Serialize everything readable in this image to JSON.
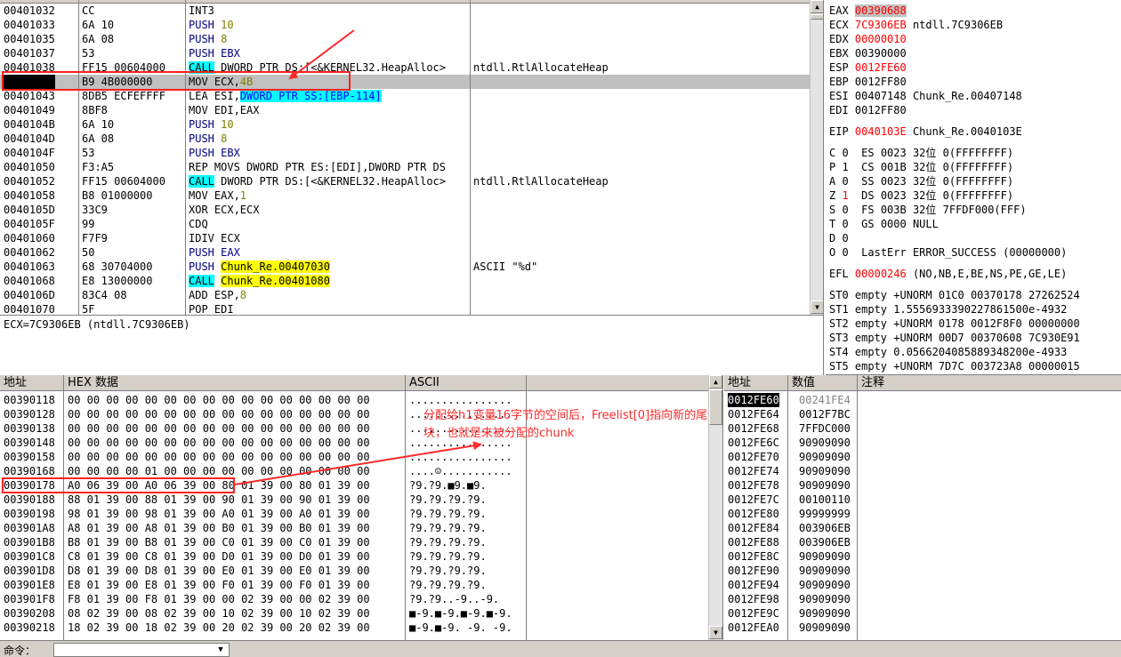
{
  "disasm": {
    "rows": [
      {
        "addr": "00401032",
        "hex": "CC",
        "asm": [
          {
            "t": "INT3"
          }
        ],
        "cmt": ""
      },
      {
        "addr": "00401033",
        "hex": "6A 10",
        "asm": [
          {
            "t": "PUSH ",
            "c": "kw-push"
          },
          {
            "t": "10",
            "c": "num"
          }
        ],
        "cmt": ""
      },
      {
        "addr": "00401035",
        "hex": "6A 08",
        "asm": [
          {
            "t": "PUSH ",
            "c": "kw-push"
          },
          {
            "t": "8",
            "c": "num"
          }
        ],
        "cmt": ""
      },
      {
        "addr": "00401037",
        "hex": "53",
        "asm": [
          {
            "t": "PUSH EBX",
            "c": "kw-push"
          }
        ],
        "cmt": ""
      },
      {
        "addr": "00401038",
        "hex": "FF15 00604000",
        "asm": [
          {
            "t": "CALL",
            "c": "kw-call"
          },
          {
            "t": " DWORD PTR DS:[<&KERNEL32.HeapAlloc>"
          }
        ],
        "cmt": "ntdll.RtlAllocateHeap"
      },
      {
        "addr": "0040103E",
        "hex": "B9 4B000000",
        "asm": [
          {
            "t": "MOV ECX,"
          },
          {
            "t": "4B",
            "c": "num"
          }
        ],
        "cmt": "",
        "cur": true
      },
      {
        "addr": "00401043",
        "hex": "8DB5 ECFEFFFF",
        "asm": [
          {
            "t": "LEA ESI,"
          },
          {
            "t": "DWORD PTR SS:[EBP-114]",
            "c": "hl-c"
          }
        ],
        "cmt": ""
      },
      {
        "addr": "00401049",
        "hex": "8BF8",
        "asm": [
          {
            "t": "MOV EDI,EAX"
          }
        ],
        "cmt": ""
      },
      {
        "addr": "0040104B",
        "hex": "6A 10",
        "asm": [
          {
            "t": "PUSH ",
            "c": "kw-push"
          },
          {
            "t": "10",
            "c": "num"
          }
        ],
        "cmt": ""
      },
      {
        "addr": "0040104D",
        "hex": "6A 08",
        "asm": [
          {
            "t": "PUSH ",
            "c": "kw-push"
          },
          {
            "t": "8",
            "c": "num"
          }
        ],
        "cmt": ""
      },
      {
        "addr": "0040104F",
        "hex": "53",
        "asm": [
          {
            "t": "PUSH EBX",
            "c": "kw-push"
          }
        ],
        "cmt": ""
      },
      {
        "addr": "00401050",
        "hex": "F3:A5",
        "asm": [
          {
            "t": "REP MOVS DWORD PTR ES:[EDI],DWORD PTR DS"
          }
        ],
        "cmt": ""
      },
      {
        "addr": "00401052",
        "hex": "FF15 00604000",
        "asm": [
          {
            "t": "CALL",
            "c": "kw-call"
          },
          {
            "t": " DWORD PTR DS:[<&KERNEL32.HeapAlloc>"
          }
        ],
        "cmt": "ntdll.RtlAllocateHeap"
      },
      {
        "addr": "00401058",
        "hex": "B8 01000000",
        "asm": [
          {
            "t": "MOV EAX,"
          },
          {
            "t": "1",
            "c": "num"
          }
        ],
        "cmt": ""
      },
      {
        "addr": "0040105D",
        "hex": "33C9",
        "asm": [
          {
            "t": "XOR ECX,ECX"
          }
        ],
        "cmt": ""
      },
      {
        "addr": "0040105F",
        "hex": "99",
        "asm": [
          {
            "t": "CDQ"
          }
        ],
        "cmt": ""
      },
      {
        "addr": "00401060",
        "hex": "F7F9",
        "asm": [
          {
            "t": "IDIV ECX"
          }
        ],
        "cmt": ""
      },
      {
        "addr": "00401062",
        "hex": "50",
        "asm": [
          {
            "t": "PUSH EAX",
            "c": "kw-push"
          }
        ],
        "cmt": ""
      },
      {
        "addr": "00401063",
        "hex": "68 30704000",
        "asm": [
          {
            "t": "PUSH ",
            "c": "kw-push"
          },
          {
            "t": "Chunk_Re.00407030",
            "c": "hl-y"
          }
        ],
        "cmt": "ASCII \"%d\""
      },
      {
        "addr": "00401068",
        "hex": "E8 13000000",
        "asm": [
          {
            "t": "CALL",
            "c": "kw-call"
          },
          {
            "t": " "
          },
          {
            "t": "Chunk_Re.00401080",
            "c": "hl-y"
          }
        ],
        "cmt": ""
      },
      {
        "addr": "0040106D",
        "hex": "83C4 08",
        "asm": [
          {
            "t": "ADD ESP,"
          },
          {
            "t": "8",
            "c": "num"
          }
        ],
        "cmt": ""
      },
      {
        "addr": "00401070",
        "hex": "5F",
        "asm": [
          {
            "t": "POP EDI"
          }
        ],
        "cmt": ""
      }
    ],
    "info": "ECX=7C9306EB (ntdll.7C9306EB)"
  },
  "registers": [
    {
      "name": "EAX",
      "val": "00390688",
      "style": "redbg",
      "cmt": ""
    },
    {
      "name": "ECX",
      "val": "7C9306EB",
      "style": "red",
      "cmt": "ntdll.7C9306EB"
    },
    {
      "name": "EDX",
      "val": "00000010",
      "style": "red",
      "cmt": ""
    },
    {
      "name": "EBX",
      "val": "00390000",
      "style": "",
      "cmt": ""
    },
    {
      "name": "ESP",
      "val": "0012FE60",
      "style": "red",
      "cmt": ""
    },
    {
      "name": "EBP",
      "val": "0012FF80",
      "style": "",
      "cmt": ""
    },
    {
      "name": "ESI",
      "val": "00407148",
      "style": "",
      "cmt": "Chunk_Re.00407148"
    },
    {
      "name": "EDI",
      "val": "0012FF80",
      "style": "",
      "cmt": ""
    },
    {
      "name": "EIP",
      "val": "0040103E",
      "style": "red",
      "cmt": "Chunk_Re.0040103E",
      "gap": true
    }
  ],
  "flags": [
    {
      "f": "C",
      "v": "0",
      "seg": "ES 0023 32位 0(FFFFFFFF)",
      "red": false
    },
    {
      "f": "P",
      "v": "1",
      "seg": "CS 001B 32位 0(FFFFFFFF)",
      "red": false
    },
    {
      "f": "A",
      "v": "0",
      "seg": "SS 0023 32位 0(FFFFFFFF)",
      "red": false
    },
    {
      "f": "Z",
      "v": "1",
      "seg": "DS 0023 32位 0(FFFFFFFF)",
      "red": true
    },
    {
      "f": "S",
      "v": "0",
      "seg": "FS 003B 32位 7FFDF000(FFF)",
      "red": false
    },
    {
      "f": "T",
      "v": "0",
      "seg": "GS 0000 NULL",
      "red": false
    },
    {
      "f": "D",
      "v": "0",
      "seg": "",
      "red": false
    },
    {
      "f": "O",
      "v": "0",
      "seg": "LastErr ERROR_SUCCESS (00000000)",
      "red": false
    }
  ],
  "efl": {
    "name": "EFL",
    "val": "00000246",
    "cmt": "(NO,NB,E,BE,NS,PE,GE,LE)"
  },
  "fpu": [
    "ST0 empty +UNORM 01C0 00370178 27262524",
    "ST1 empty 1.5556933390227861500e-4932",
    "ST2 empty +UNORM 0178 0012F8F0 00000000",
    "ST3 empty +UNORM 00D7 00370608 7C930E91",
    "ST4 empty 0.0566204085889348200e-4933",
    "ST5 empty +UNORM 7D7C 003723A8 00000015"
  ],
  "dump": {
    "headers": {
      "addr": "地址",
      "hex": "HEX 数据",
      "ascii": "ASCII"
    },
    "rows": [
      {
        "addr": "00390118",
        "hex": "00 00 00 00 00 00 00 00 00 00 00 00 00 00 00 00",
        "asc": "................"
      },
      {
        "addr": "00390128",
        "hex": "00 00 00 00 00 00 00 00 00 00 00 00 00 00 00 00",
        "asc": "................"
      },
      {
        "addr": "00390138",
        "hex": "00 00 00 00 00 00 00 00 00 00 00 00 00 00 00 00",
        "asc": "................"
      },
      {
        "addr": "00390148",
        "hex": "00 00 00 00 00 00 00 00 00 00 00 00 00 00 00 00",
        "asc": "................"
      },
      {
        "addr": "00390158",
        "hex": "00 00 00 00 00 00 00 00 00 00 00 00 00 00 00 00",
        "asc": "................"
      },
      {
        "addr": "00390168",
        "hex": "00 00 00 00 01 00 00 00 00 00 00 00 00 00 00 00",
        "asc": "....☺..........."
      },
      {
        "addr": "00390178",
        "hex": "A0 06 39 00 A0 06 39 00 80 01 39 00 80 01 39 00",
        "asc": "?9.?9.■9.■9."
      },
      {
        "addr": "00390188",
        "hex": "88 01 39 00 88 01 39 00 90 01 39 00 90 01 39 00",
        "asc": "?9.?9.?9.?9."
      },
      {
        "addr": "00390198",
        "hex": "98 01 39 00 98 01 39 00 A0 01 39 00 A0 01 39 00",
        "asc": "?9.?9.?9.?9."
      },
      {
        "addr": "003901A8",
        "hex": "A8 01 39 00 A8 01 39 00 B0 01 39 00 B0 01 39 00",
        "asc": "?9.?9.?9.?9."
      },
      {
        "addr": "003901B8",
        "hex": "B8 01 39 00 B8 01 39 00 C0 01 39 00 C0 01 39 00",
        "asc": "?9.?9.?9.?9."
      },
      {
        "addr": "003901C8",
        "hex": "C8 01 39 00 C8 01 39 00 D0 01 39 00 D0 01 39 00",
        "asc": "?9.?9.?9.?9."
      },
      {
        "addr": "003901D8",
        "hex": "D8 01 39 00 D8 01 39 00 E0 01 39 00 E0 01 39 00",
        "asc": "?9.?9.?9.?9."
      },
      {
        "addr": "003901E8",
        "hex": "E8 01 39 00 E8 01 39 00 F0 01 39 00 F0 01 39 00",
        "asc": "?9.?9.?9.?9."
      },
      {
        "addr": "003901F8",
        "hex": "F8 01 39 00 F8 01 39 00 00 02 39 00 00 02 39 00",
        "asc": "?9.?9..-9..-9."
      },
      {
        "addr": "00390208",
        "hex": "08 02 39 00 08 02 39 00 10 02 39 00 10 02 39 00",
        "asc": "■-9.■-9.■-9.■-9."
      },
      {
        "addr": "00390218",
        "hex": "18 02 39 00 18 02 39 00 20 02 39 00 20 02 39 00",
        "asc": "■-9.■-9. -9. -9."
      }
    ]
  },
  "stack": {
    "headers": {
      "addr": "地址",
      "val": "数值",
      "cmt": "注释"
    },
    "rows": [
      {
        "addr": "0012FE60",
        "val": "00241FE4",
        "sel": true
      },
      {
        "addr": "0012FE64",
        "val": "0012F7BC"
      },
      {
        "addr": "0012FE68",
        "val": "7FFDC000"
      },
      {
        "addr": "0012FE6C",
        "val": "90909090"
      },
      {
        "addr": "0012FE70",
        "val": "90909090"
      },
      {
        "addr": "0012FE74",
        "val": "90909090"
      },
      {
        "addr": "0012FE78",
        "val": "90909090"
      },
      {
        "addr": "0012FE7C",
        "val": "00100110"
      },
      {
        "addr": "0012FE80",
        "val": "99999999"
      },
      {
        "addr": "0012FE84",
        "val": "003906EB"
      },
      {
        "addr": "0012FE88",
        "val": "003906EB"
      },
      {
        "addr": "0012FE8C",
        "val": "90909090"
      },
      {
        "addr": "0012FE90",
        "val": "90909090"
      },
      {
        "addr": "0012FE94",
        "val": "90909090"
      },
      {
        "addr": "0012FE98",
        "val": "90909090"
      },
      {
        "addr": "0012FE9C",
        "val": "90909090"
      },
      {
        "addr": "0012FEA0",
        "val": "90909090"
      }
    ]
  },
  "command": {
    "label": "命令：",
    "value": ""
  },
  "annotation": {
    "note": "分配给h1变量16字节的空间后，Freelist[0]指向新的尾块，也就是未被分配的chunk"
  }
}
